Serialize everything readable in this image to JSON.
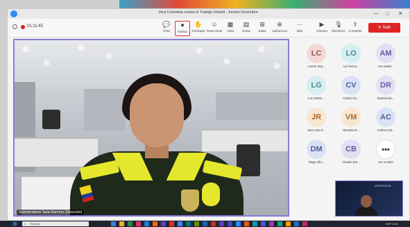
{
  "window": {
    "title": "Red Colombia contra el Trabajo Infantil - Sesión Diciembre",
    "timer": "01:11:45",
    "controls": {
      "minimize": "—",
      "maximize": "□",
      "close": "✕"
    }
  },
  "toolbar": {
    "items": [
      {
        "label": "Chat",
        "icon": "chat-icon",
        "glyph": "💬"
      },
      {
        "label": "Grabar",
        "icon": "record-icon",
        "glyph": "⏺"
      },
      {
        "label": "Participar",
        "icon": "participate-icon",
        "glyph": "✋"
      },
      {
        "label": "Reaccionar",
        "icon": "reaction-icon",
        "glyph": "☺"
      },
      {
        "label": "Vista",
        "icon": "view-icon",
        "glyph": "▦"
      },
      {
        "label": "Notas",
        "icon": "notes-icon",
        "glyph": "▤"
      },
      {
        "label": "Salas",
        "icon": "rooms-icon",
        "glyph": "⊞"
      },
      {
        "label": "Aplicaciones",
        "icon": "apps-icon",
        "glyph": "⊕"
      },
      {
        "label": "Más",
        "icon": "more-icon",
        "glyph": "⋯"
      },
      {
        "label": "Cámara",
        "icon": "camera-icon",
        "glyph": "▶"
      },
      {
        "label": "Micrófono",
        "icon": "microphone-icon",
        "glyph": "🎙"
      },
      {
        "label": "Compartir",
        "icon": "share-icon",
        "glyph": "⇪"
      }
    ],
    "leave_label": "✕ Salir"
  },
  "main_video": {
    "speaker_name": "Subintendente Tania Ramírez (Dirección)"
  },
  "participants": [
    {
      "initials": "LC",
      "name": "Leonor Sep...",
      "color": "#f3d9d6",
      "text": "#8b5a56"
    },
    {
      "initials": "LO",
      "name": "Luz Herna...",
      "color": "#d6eef2",
      "text": "#4a8a94"
    },
    {
      "initials": "AM",
      "name": "Ana Isabel...",
      "color": "#e3def3",
      "text": "#6b5ca3"
    },
    {
      "initials": "LG",
      "name": "Luz Gabrie...",
      "color": "#d6eef2",
      "text": "#4a8a94"
    },
    {
      "initials": "CV",
      "name": "Camilo Ro...",
      "color": "#d9e2f5",
      "text": "#4a5f99"
    },
    {
      "initials": "DR",
      "name": "Daniela Ma...",
      "color": "#e3def3",
      "text": "#6b5ca3"
    },
    {
      "initials": "JR",
      "name": "Jairo Ivan R...",
      "color": "#f7e6d2",
      "text": "#a66a2e"
    },
    {
      "initials": "VM",
      "name": "Valentina R...",
      "color": "#f7e6d2",
      "text": "#a66a2e"
    },
    {
      "initials": "AC",
      "name": "Andrea Cat...",
      "color": "#d9e2f5",
      "text": "#4a5f99"
    },
    {
      "initials": "DM",
      "name": "Diego Alfo...",
      "color": "#d9e2f5",
      "text": "#4a5f99"
    },
    {
      "initials": "CB",
      "name": "Claudia Bar...",
      "color": "#e3def3",
      "text": "#6b5ca3"
    },
    {
      "initials": "•••",
      "name": "Ver a todos",
      "color": "#ffffff",
      "text": "#333333"
    }
  ],
  "mini_video": {
    "logo_text": "ASISTENCIA"
  },
  "taskbar": {
    "search_placeholder": "Buscar",
    "clock": "RSP 5:35"
  }
}
